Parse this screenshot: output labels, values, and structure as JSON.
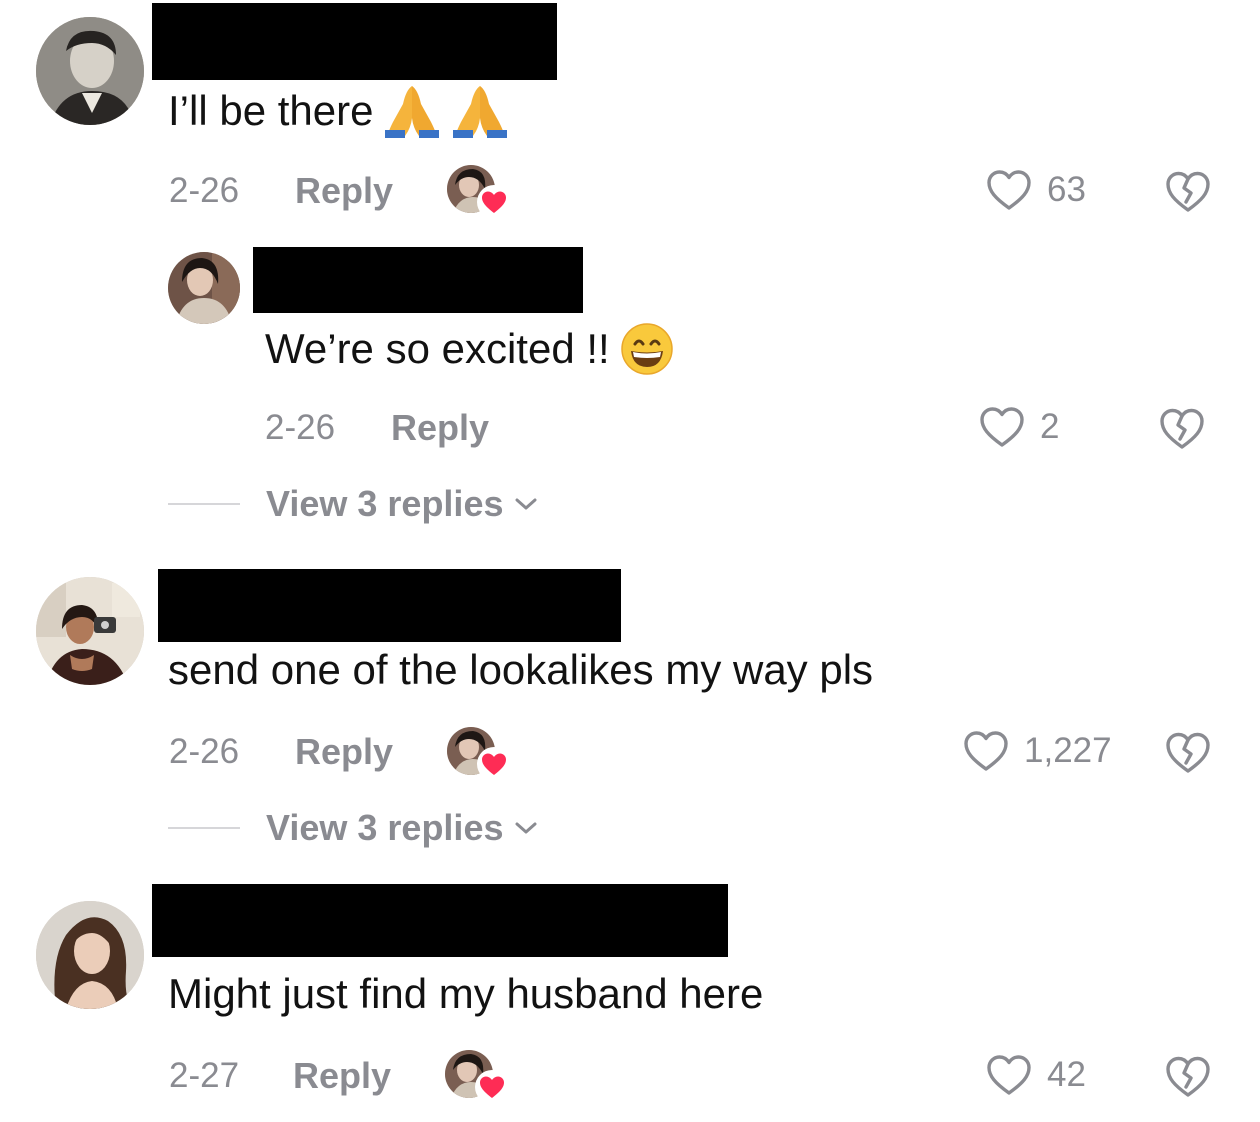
{
  "comments": [
    {
      "text": "I’ll be there",
      "emoji": [
        "folded-hands-emoji",
        "folded-hands-emoji"
      ],
      "date": "2-26",
      "reply_label": "Reply",
      "liked_by_creator": true,
      "likes": "63",
      "reply": {
        "text": "We’re so excited !!",
        "emoji": [
          "grinning-face-emoji"
        ],
        "date": "2-26",
        "reply_label": "Reply",
        "likes": "2"
      },
      "view_replies": "View 3 replies"
    },
    {
      "text": "send one of the lookalikes my way pls",
      "date": "2-26",
      "reply_label": "Reply",
      "liked_by_creator": true,
      "likes": "1,227",
      "view_replies": "View 3 replies"
    },
    {
      "text": "Might just find my husband here",
      "date": "2-27",
      "reply_label": "Reply",
      "liked_by_creator": true,
      "likes": "42"
    }
  ],
  "colors": {
    "text": "#121212",
    "meta": "#8a8b91",
    "heart_red": "#fe2c55",
    "redaction": "#000000"
  },
  "icons": {
    "like": "heart-outline-icon",
    "dislike": "broken-heart-icon",
    "creator_like": "creator-liked-heart-icon",
    "expand": "chevron-down-icon"
  }
}
